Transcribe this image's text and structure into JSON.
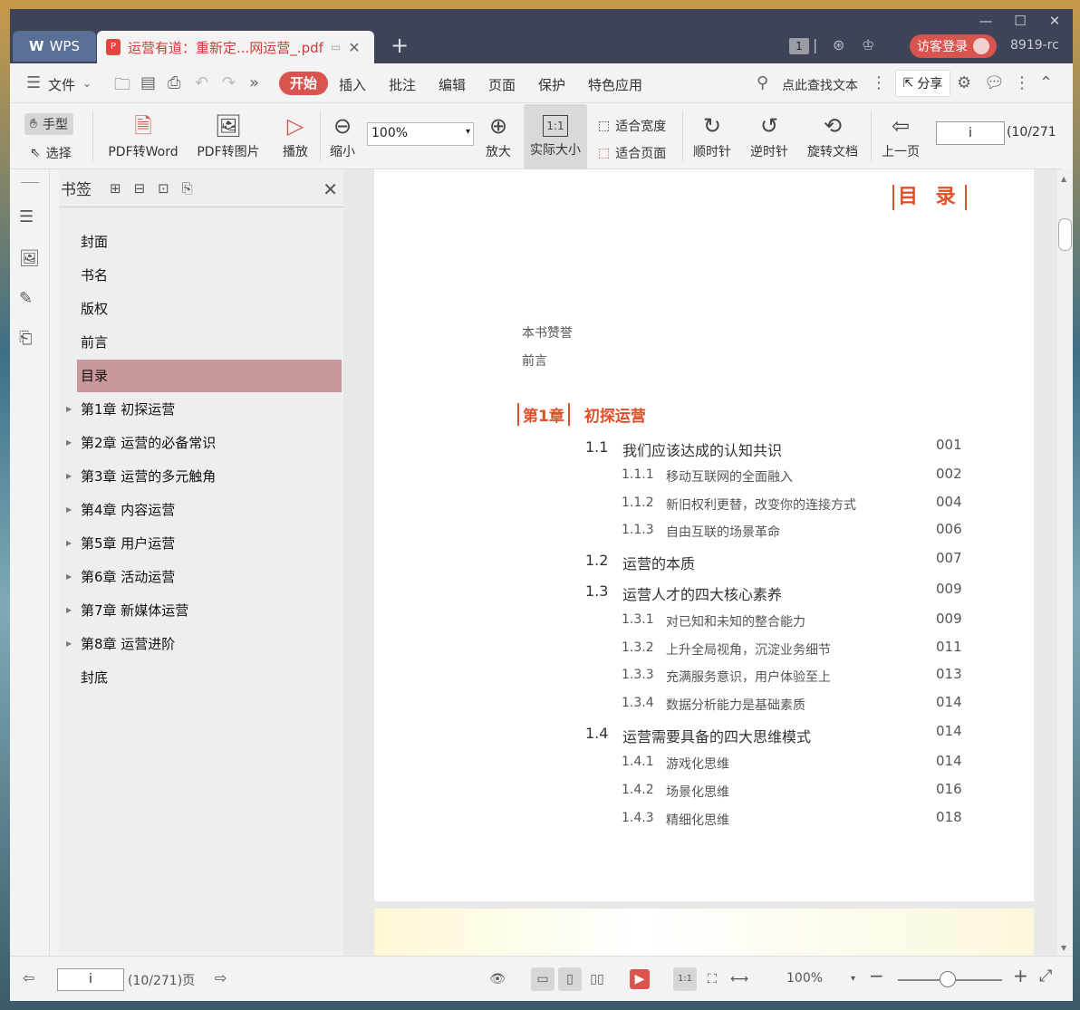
{
  "titlebar": {
    "wps_tab": "WPS",
    "doc_tab": "运营有道：重新定...网运营_.pdf",
    "new_tab": "+",
    "window_badge": "1",
    "login": "访客登录",
    "user_id": "8919-rc",
    "min": "—",
    "max": "☐",
    "close": "✕"
  },
  "menubar": {
    "file": "文件",
    "start": "开始",
    "items": [
      "插入",
      "批注",
      "编辑",
      "页面",
      "保护",
      "特色应用"
    ],
    "search": "点此查找文本",
    "share": "分享"
  },
  "toolbar": {
    "hand": "手型",
    "select": "选择",
    "pdf_to_word": "PDF转Word",
    "pdf_to_image": "PDF转图片",
    "play": "播放",
    "zoom_out": "缩小",
    "zoom_value": "100%",
    "zoom_in": "放大",
    "actual_size": "实际大小",
    "fit_width": "适合宽度",
    "fit_page": "适合页面",
    "clockwise": "顺时针",
    "counter_clockwise": "逆时针",
    "rotate_doc": "旋转文档",
    "prev_page": "上一页",
    "page_input": "i",
    "page_count": "(10/271"
  },
  "bookmarks": {
    "title": "书签",
    "items": [
      {
        "label": "封面",
        "expandable": false,
        "selected": false
      },
      {
        "label": "书名",
        "expandable": false,
        "selected": false
      },
      {
        "label": "版权",
        "expandable": false,
        "selected": false
      },
      {
        "label": "前言",
        "expandable": false,
        "selected": false
      },
      {
        "label": "目录",
        "expandable": false,
        "selected": true
      },
      {
        "label": "第1章  初探运营",
        "expandable": true,
        "selected": false
      },
      {
        "label": "第2章  运营的必备常识",
        "expandable": true,
        "selected": false
      },
      {
        "label": "第3章  运营的多元触角",
        "expandable": true,
        "selected": false
      },
      {
        "label": "第4章  内容运营",
        "expandable": true,
        "selected": false
      },
      {
        "label": "第5章  用户运营",
        "expandable": true,
        "selected": false
      },
      {
        "label": "第6章  活动运营",
        "expandable": true,
        "selected": false
      },
      {
        "label": "第7章  新媒体运营",
        "expandable": true,
        "selected": false
      },
      {
        "label": "第8章  运营进阶",
        "expandable": true,
        "selected": false
      },
      {
        "label": "封底",
        "expandable": false,
        "selected": false
      }
    ]
  },
  "document": {
    "toc_title": "目 录",
    "front": [
      "本书赞誉",
      "前言"
    ],
    "chapter_num": "第1章",
    "chapter_title": "初探运营",
    "entries": [
      {
        "num": "1.1",
        "title": "我们应该达成的认知共识",
        "page": "001",
        "level": 1
      },
      {
        "num": "1.1.1",
        "title": "移动互联网的全面融入",
        "page": "002",
        "level": 2
      },
      {
        "num": "1.1.2",
        "title": "新旧权利更替，改变你的连接方式",
        "page": "004",
        "level": 2
      },
      {
        "num": "1.1.3",
        "title": "自由互联的场景革命",
        "page": "006",
        "level": 2
      },
      {
        "num": "1.2",
        "title": "运营的本质",
        "page": "007",
        "level": 1
      },
      {
        "num": "1.3",
        "title": "运营人才的四大核心素养",
        "page": "009",
        "level": 1
      },
      {
        "num": "1.3.1",
        "title": "对已知和未知的整合能力",
        "page": "009",
        "level": 2
      },
      {
        "num": "1.3.2",
        "title": "上升全局视角，沉淀业务细节",
        "page": "011",
        "level": 2
      },
      {
        "num": "1.3.3",
        "title": "充满服务意识，用户体验至上",
        "page": "013",
        "level": 2
      },
      {
        "num": "1.3.4",
        "title": "数据分析能力是基础素质",
        "page": "014",
        "level": 2
      },
      {
        "num": "1.4",
        "title": "运营需要具备的四大思维模式",
        "page": "014",
        "level": 1
      },
      {
        "num": "1.4.1",
        "title": "游戏化思维",
        "page": "014",
        "level": 2
      },
      {
        "num": "1.4.2",
        "title": "场景化思维",
        "page": "016",
        "level": 2
      },
      {
        "num": "1.4.3",
        "title": "精细化思维",
        "page": "018",
        "level": 2
      }
    ]
  },
  "statusbar": {
    "page_input": "i",
    "page_count": "(10/271)页",
    "zoom": "100%",
    "fit_1to1": "1:1"
  },
  "colors": {
    "accent": "#d9534f",
    "toc_red": "#e0502a",
    "selection": "#c9989c",
    "titlebar": "#3f4358"
  }
}
